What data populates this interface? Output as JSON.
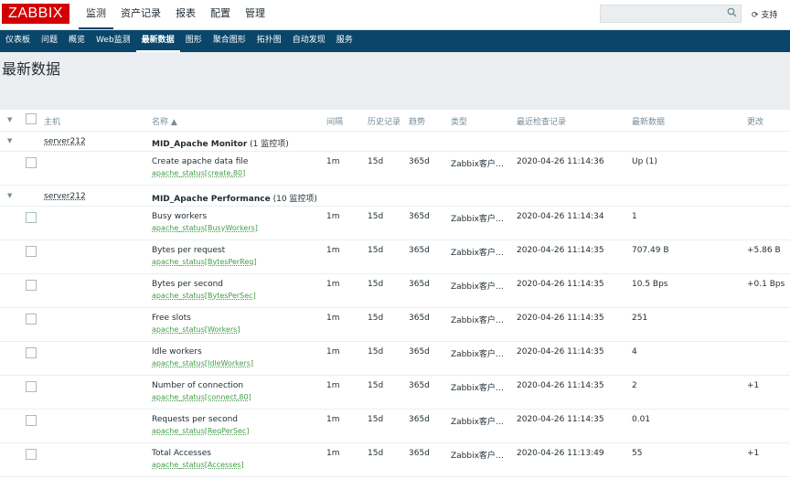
{
  "app": {
    "logo": "ZABBIX",
    "support": "支持"
  },
  "topmenu": [
    "监测",
    "资产记录",
    "报表",
    "配置",
    "管理"
  ],
  "submenu": [
    "仪表板",
    "问题",
    "概览",
    "Web监测",
    "最新数据",
    "图形",
    "聚合图形",
    "拓扑图",
    "自动发现",
    "服务"
  ],
  "page_title": "最新数据",
  "columns": {
    "host": "主机",
    "name": "名称 ▲",
    "interval": "间隔",
    "history": "历史记录",
    "trends": "趋势",
    "type": "类型",
    "lastcheck": "最近检查记录",
    "lastvalue": "最新数据",
    "change": "更改"
  },
  "groups": [
    {
      "host": "server212",
      "app": "MID_Apache Monitor",
      "count": "(1 监控项)"
    },
    {
      "host": "server212",
      "app": "MID_Apache Performance",
      "count": "(10 监控项)"
    }
  ],
  "items": [
    {
      "name": "Create apache data file",
      "key": "apache_status[create,80]",
      "interval": "1m",
      "history": "15d",
      "trends": "365d",
      "type": "Zabbix客户…",
      "lastcheck": "2020-04-26 11:14:36",
      "lastvalue": "Up (1)",
      "change": ""
    },
    {
      "name": "Busy workers",
      "key": "apache_status[BusyWorkers]",
      "interval": "1m",
      "history": "15d",
      "trends": "365d",
      "type": "Zabbix客户…",
      "lastcheck": "2020-04-26 11:14:34",
      "lastvalue": "1",
      "change": ""
    },
    {
      "name": "Bytes per request",
      "key": "apache_status[BytesPerReq]",
      "interval": "1m",
      "history": "15d",
      "trends": "365d",
      "type": "Zabbix客户…",
      "lastcheck": "2020-04-26 11:14:35",
      "lastvalue": "707.49 B",
      "change": "+5.86 B"
    },
    {
      "name": "Bytes per second",
      "key": "apache_status[BytesPerSec]",
      "interval": "1m",
      "history": "15d",
      "trends": "365d",
      "type": "Zabbix客户…",
      "lastcheck": "2020-04-26 11:14:35",
      "lastvalue": "10.5 Bps",
      "change": "+0.1 Bps"
    },
    {
      "name": "Free slots",
      "key": "apache_status[Workers]",
      "interval": "1m",
      "history": "15d",
      "trends": "365d",
      "type": "Zabbix客户…",
      "lastcheck": "2020-04-26 11:14:35",
      "lastvalue": "251",
      "change": ""
    },
    {
      "name": "Idle workers",
      "key": "apache_status[IdleWorkers]",
      "interval": "1m",
      "history": "15d",
      "trends": "365d",
      "type": "Zabbix客户…",
      "lastcheck": "2020-04-26 11:14:35",
      "lastvalue": "4",
      "change": ""
    },
    {
      "name": "Number of connection",
      "key": "apache_status[connect,80]",
      "interval": "1m",
      "history": "15d",
      "trends": "365d",
      "type": "Zabbix客户…",
      "lastcheck": "2020-04-26 11:14:35",
      "lastvalue": "2",
      "change": "+1"
    },
    {
      "name": "Requests per second",
      "key": "apache_status[ReqPerSec]",
      "interval": "1m",
      "history": "15d",
      "trends": "365d",
      "type": "Zabbix客户…",
      "lastcheck": "2020-04-26 11:14:35",
      "lastvalue": "0.01",
      "change": ""
    },
    {
      "name": "Total Accesses",
      "key": "apache_status[Accesses]",
      "interval": "1m",
      "history": "15d",
      "trends": "365d",
      "type": "Zabbix客户…",
      "lastcheck": "2020-04-26 11:13:49",
      "lastvalue": "55",
      "change": "+1"
    }
  ]
}
